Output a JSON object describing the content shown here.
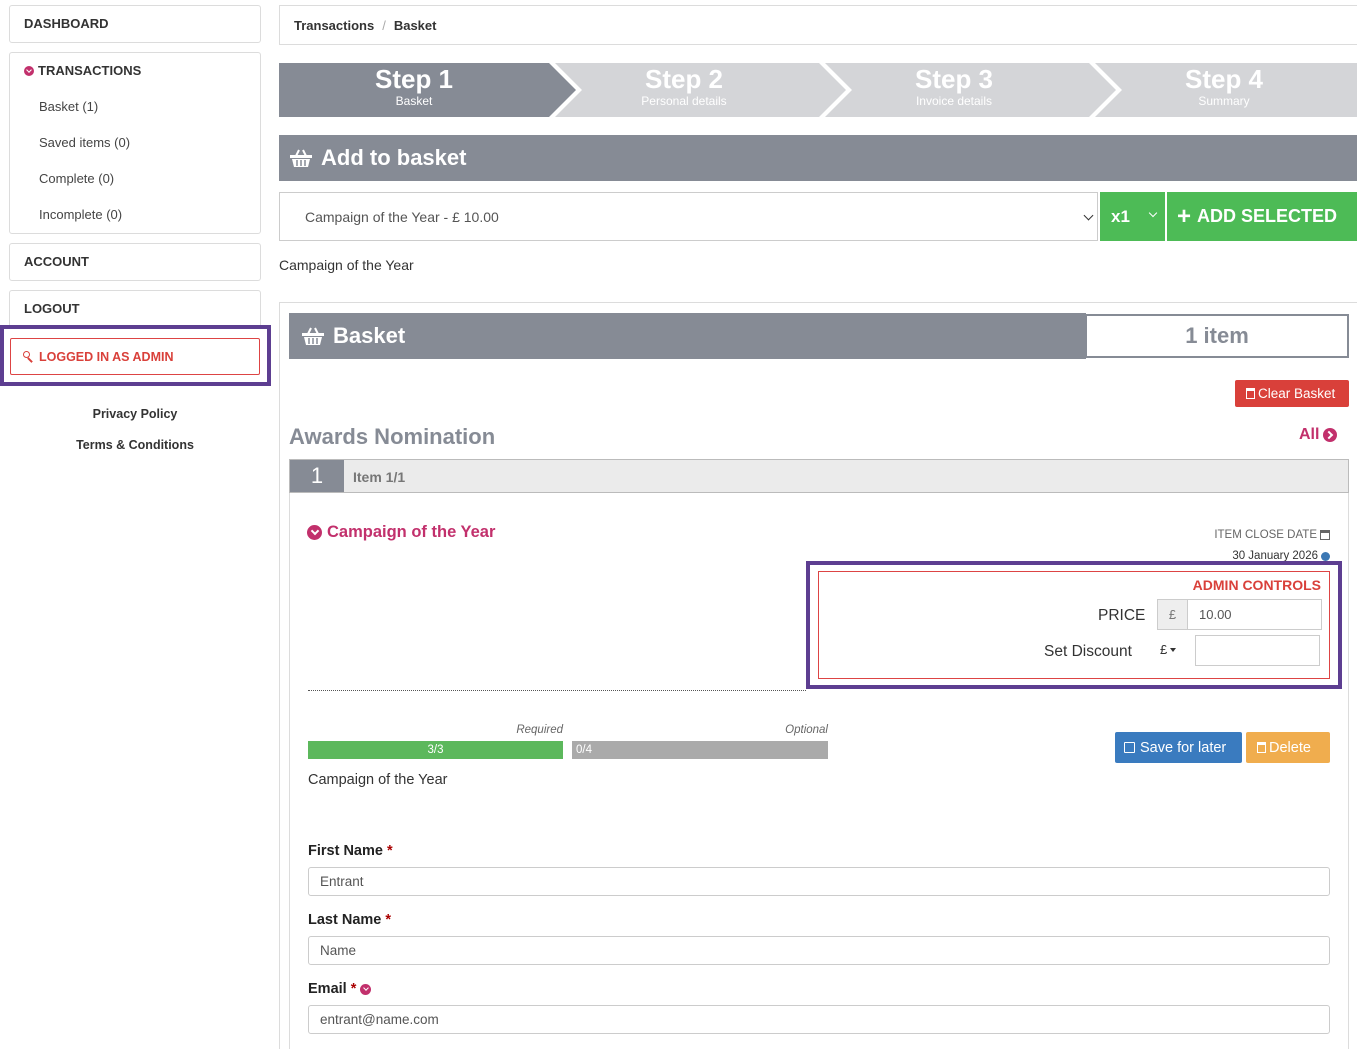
{
  "sidebar": {
    "dashboard": "DASHBOARD",
    "transactions": {
      "title": "TRANSACTIONS",
      "items": [
        "Basket (1)",
        "Saved items (0)",
        "Complete (0)",
        "Incomplete (0)"
      ]
    },
    "account": "ACCOUNT",
    "logout": "LOGOUT",
    "admin_badge": "LOGGED IN AS ADMIN",
    "footer_links": [
      "Privacy Policy",
      "Terms & Conditions"
    ]
  },
  "breadcrumb": {
    "items": [
      "Transactions",
      "Basket"
    ],
    "separator": "/"
  },
  "steps": [
    {
      "title": "Step 1",
      "subtitle": "Basket",
      "active": true
    },
    {
      "title": "Step 2",
      "subtitle": "Personal details",
      "active": false
    },
    {
      "title": "Step 3",
      "subtitle": "Invoice details",
      "active": false
    },
    {
      "title": "Step 4",
      "subtitle": "Summary",
      "active": false
    }
  ],
  "add_to_basket": {
    "title": "Add to basket",
    "selected_option": "Campaign of the Year  - £ 10.00",
    "quantity": "x1",
    "add_button": "ADD SELECTED",
    "selected_description": "Campaign of the Year"
  },
  "basket": {
    "title": "Basket",
    "item_count": "1 item",
    "clear_button": "Clear Basket",
    "section_title": "Awards Nomination",
    "all_link": "All",
    "item_number": "1",
    "item_label": "Item 1/1",
    "item_name": "Campaign of the Year",
    "close_date_label": "ITEM CLOSE DATE",
    "close_date": "30 January 2026",
    "admin_controls": {
      "title": "ADMIN CONTROLS",
      "price_label": "PRICE",
      "currency": "£",
      "price_value": "10.00",
      "discount_label": "Set Discount",
      "discount_currency": "£",
      "discount_value": ""
    },
    "progress": {
      "required_label": "Required",
      "required_text": "3/3",
      "required_fraction": 1.0,
      "optional_label": "Optional",
      "optional_text": "0/4",
      "optional_fraction": 0.0
    },
    "save_button": "Save for later",
    "delete_button": "Delete",
    "description": "Campaign of the Year",
    "fields": [
      {
        "label": "First Name",
        "required_mark": "*",
        "value": "Entrant"
      },
      {
        "label": "Last Name",
        "required_mark": "*",
        "value": "Name"
      },
      {
        "label": "Email",
        "required_mark": "*",
        "value": "entrant@name.com"
      }
    ]
  },
  "colors": {
    "accent": "#c2306c",
    "step_active": "#868b95",
    "step_inactive": "#d4d5d8",
    "success": "#4dbb56",
    "danger": "#d9403a",
    "primary": "#3a7bbf",
    "warning": "#f0ad4e",
    "highlight_outline": "#5d3e91"
  }
}
